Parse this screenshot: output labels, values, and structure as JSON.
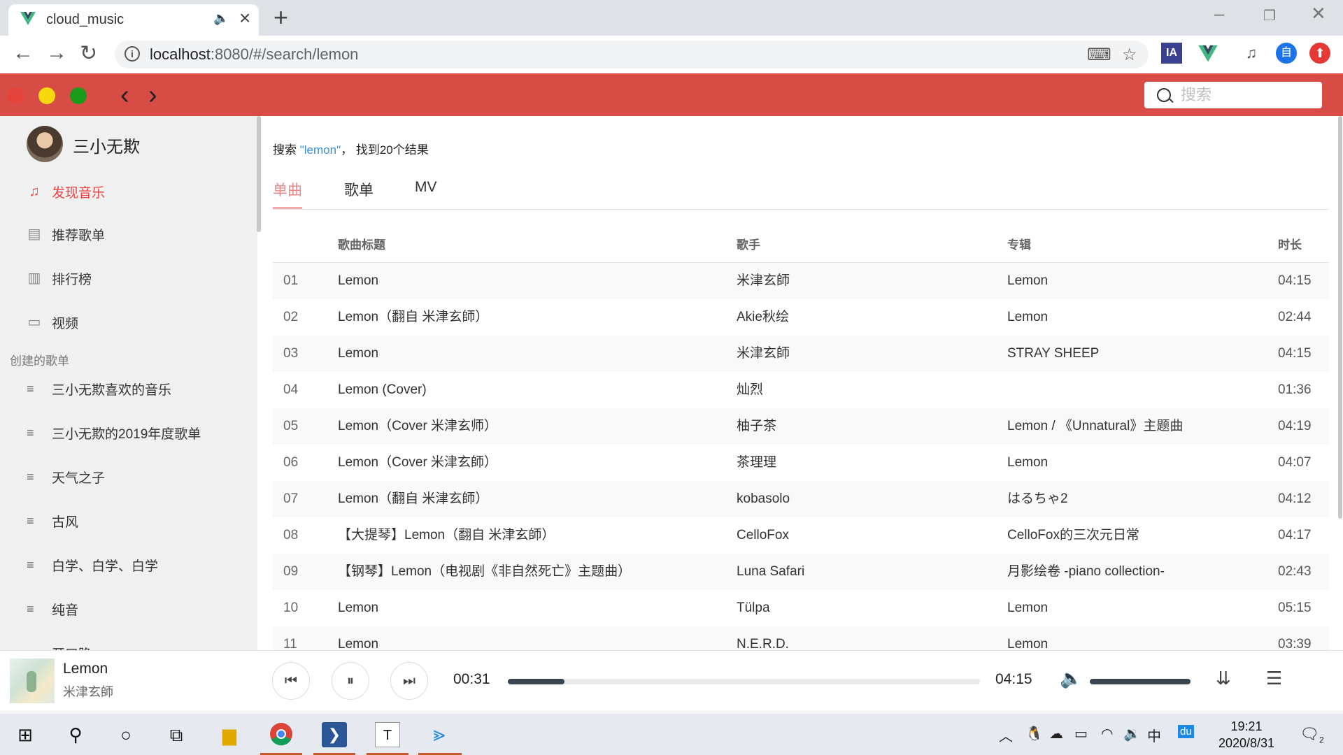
{
  "browser": {
    "tab_title": "cloud_music",
    "url_host": "localhost",
    "url_rest": ":8080/#/search/lemon",
    "ext_ia": "IA",
    "ext_user": "自"
  },
  "app": {
    "search_placeholder": "搜索",
    "user_name": "三小无欺",
    "menu": [
      {
        "label": "发现音乐",
        "icon": "music-note-icon"
      },
      {
        "label": "推荐歌单",
        "icon": "playlist-doc-icon"
      },
      {
        "label": "排行榜",
        "icon": "bar-chart-icon"
      },
      {
        "label": "视频",
        "icon": "video-icon"
      }
    ],
    "created_title": "创建的歌单",
    "playlists": [
      "三小无欺喜欢的音乐",
      "三小无欺的2019年度歌单",
      "天气之子",
      "古风",
      "白学、白学、白学",
      "纯音",
      "开口跪"
    ]
  },
  "search": {
    "prefix": "搜索 ",
    "keyword": "\"lemon\"",
    "suffix": "， 找到20个结果",
    "tabs": [
      "单曲",
      "歌单",
      "MV"
    ],
    "headers": {
      "title": "歌曲标题",
      "artist": "歌手",
      "album": "专辑",
      "duration": "时长"
    },
    "rows": [
      {
        "idx": "01",
        "title": "Lemon",
        "artist": "米津玄師",
        "album": "Lemon",
        "dur": "04:15"
      },
      {
        "idx": "02",
        "title": "Lemon（翻自 米津玄師）",
        "artist": "Akie秋绘",
        "album": "Lemon",
        "dur": "02:44"
      },
      {
        "idx": "03",
        "title": "Lemon",
        "artist": "米津玄師",
        "album": "STRAY SHEEP",
        "dur": "04:15"
      },
      {
        "idx": "04",
        "title": "Lemon (Cover)",
        "artist": "灿烈",
        "album": "",
        "dur": "01:36"
      },
      {
        "idx": "05",
        "title": "Lemon（Cover 米津玄师）",
        "artist": "柚子茶",
        "album": "Lemon / 《Unnatural》主题曲",
        "dur": "04:19"
      },
      {
        "idx": "06",
        "title": "Lemon（Cover 米津玄師）",
        "artist": "茶理理",
        "album": "Lemon",
        "dur": "04:07"
      },
      {
        "idx": "07",
        "title": "Lemon（翻自 米津玄師）",
        "artist": "kobasolo",
        "album": "はるちゃ2",
        "dur": "04:12"
      },
      {
        "idx": "08",
        "title": "【大提琴】Lemon（翻自 米津玄師）",
        "artist": "CelloFox",
        "album": "CelloFox的三次元日常",
        "dur": "04:17"
      },
      {
        "idx": "09",
        "title": "【钢琴】Lemon（电视剧《非自然死亡》主题曲）",
        "artist": "Luna Safari",
        "album": "月影绘卷 -piano collection-",
        "dur": "02:43"
      },
      {
        "idx": "10",
        "title": "Lemon",
        "artist": "Tülpa",
        "album": "Lemon",
        "dur": "05:15"
      },
      {
        "idx": "11",
        "title": "Lemon",
        "artist": "N.E.R.D.",
        "album": "Lemon",
        "dur": "03:39"
      }
    ]
  },
  "player": {
    "title": "Lemon",
    "artist": "米津玄師",
    "current": "00:31",
    "total": "04:15",
    "progress": 0.12,
    "volume": 1.0
  },
  "taskbar": {
    "time": "19:21",
    "date": "2020/8/31",
    "tray_ime": "中",
    "tray_baidu": "du",
    "notif_count": "2"
  },
  "colors": {
    "accent": "#d74d45",
    "active_menu": "#ee4444",
    "tab_active": "#ec8a8a",
    "keyword": "#3b8fd8"
  }
}
